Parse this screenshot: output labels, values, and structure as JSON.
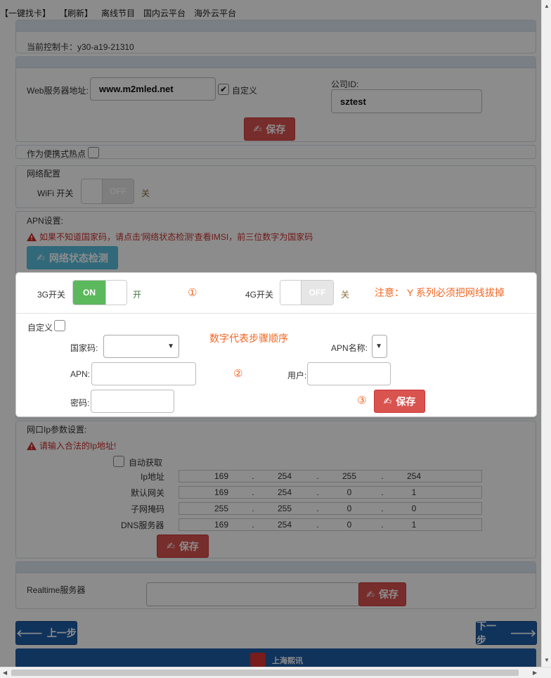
{
  "topnav": [
    "【一键找卡】",
    "【刷新】",
    "离线节目",
    "国内云平台",
    "海外云平台"
  ],
  "card": {
    "label": "当前控制卡：y30-a19-21310"
  },
  "web": {
    "server_label": "Web服务器地址:",
    "server_value": "www.m2mled.net",
    "custom_label": "自定义",
    "company_label": "公司ID:",
    "company_value": "sztest",
    "save_label": "保存"
  },
  "hotspot": {
    "label": "作为便携式热点"
  },
  "network": {
    "title": "网络配置",
    "wifi_label": "WiFi 开关",
    "wifi_toggle": "OFF",
    "wifi_state": "关"
  },
  "apn": {
    "title": "APN设置:",
    "warning": "如果不知道国家码，请点击'网络状态检测'查看IMSI，前三位数字为国家码",
    "detect_label": "网络状态检测"
  },
  "modal": {
    "g3_label": "3G开关",
    "g3_toggle": "ON",
    "g3_state": "开",
    "step1": "①",
    "g4_label": "4G开关",
    "g4_toggle": "OFF",
    "g4_state": "关",
    "notice": "注意： Y 系列必须把网线拔掉",
    "custom_label": "自定义",
    "order_note": "数字代表步骤顺序",
    "country_label": "国家码:",
    "apn_name_label": "APN名称:",
    "apn_label": "APN:",
    "step2": "②",
    "user_label": "用户:",
    "password_label": "密码:",
    "step3": "③",
    "save_label": "保存"
  },
  "ethernet": {
    "title": "网口Ip参数设置:",
    "warning": "请输入合法的Ip地址!",
    "auto_label": "自动获取",
    "rows": [
      {
        "label": "Ip地址",
        "octets": [
          "169",
          "254",
          "255",
          "254"
        ]
      },
      {
        "label": "默认网关",
        "octets": [
          "169",
          "254",
          "0",
          "1"
        ]
      },
      {
        "label": "子网掩码",
        "octets": [
          "255",
          "255",
          "0",
          "0"
        ]
      },
      {
        "label": "DNS服务器",
        "octets": [
          "169",
          "254",
          "0",
          "1"
        ]
      }
    ],
    "dot": ".",
    "save_label": "保存"
  },
  "realtime": {
    "label": "Realtime服务器",
    "save_label": "保存"
  },
  "nav": {
    "prev_label": "上一步",
    "next_label": "下一步"
  },
  "footer": {
    "brand": "上海熙讯"
  },
  "colors": {
    "danger": "#d9534f",
    "primary": "#1e5da8",
    "info": "#5bc0de",
    "success": "#5cb85c",
    "annotation": "#f26522"
  }
}
